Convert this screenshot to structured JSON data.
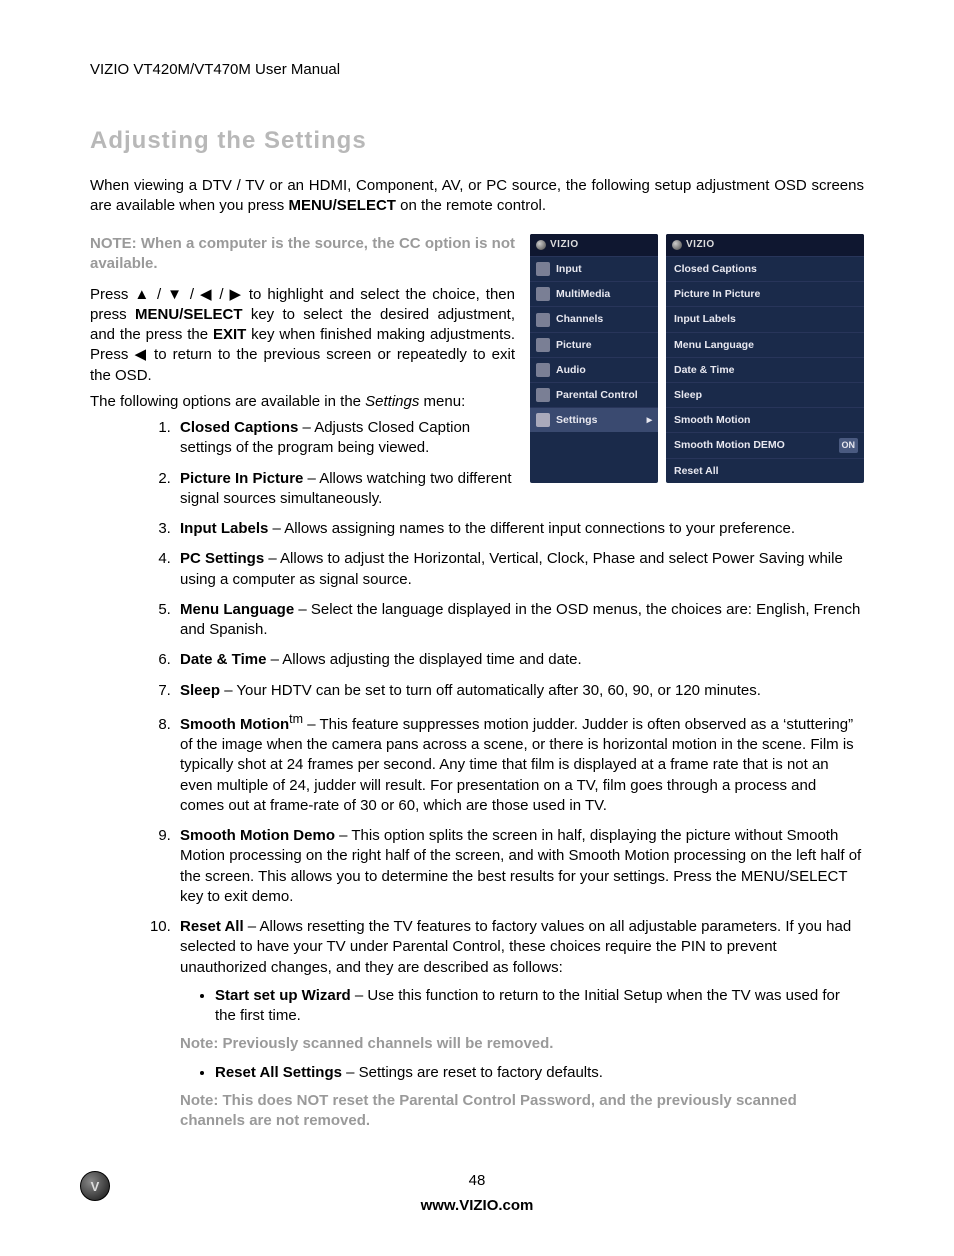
{
  "header": "VIZIO VT420M/VT470M User Manual",
  "title": "Adjusting the Settings",
  "intro_pre": "When viewing a DTV / TV or an HDMI, Component, AV, or PC source, the following setup adjustment OSD screens are available when you press ",
  "intro_bold": "MENU/SELECT",
  "intro_post": " on the remote control.",
  "note1": "NOTE: When a computer is the source, the CC option is not available.",
  "nav_p1a": "Press ",
  "nav_arrows": "▲ / ▼ / ◀ / ▶",
  "nav_p1b": " to highlight and select the choice, then press ",
  "nav_b1": "MENU/SELECT",
  "nav_p1c": " key to select the desired adjustment, and the press the ",
  "nav_b2": "EXIT",
  "nav_p1d": " key when finished making adjustments. Press ",
  "nav_arrow_left": "◀",
  "nav_p1e": " to return to the previous screen or repeatedly to exit the OSD.",
  "avail_pre": "The following options are available in the ",
  "avail_em": "Settings",
  "avail_post": " menu:",
  "osd_brand": "VIZIO",
  "osd_left": [
    "Input",
    "MultiMedia",
    "Channels",
    "Picture",
    "Audio",
    "Parental Control",
    "Settings"
  ],
  "osd_right": [
    "Closed Captions",
    "Picture In Picture",
    "Input Labels",
    "Menu Language",
    "Date & Time",
    "Sleep",
    "Smooth Motion",
    "Smooth Motion DEMO",
    "Reset All"
  ],
  "osd_demo_badge": "ON",
  "list": [
    {
      "t": "Closed Captions",
      "d": " – Adjusts Closed Caption settings of the program being viewed."
    },
    {
      "t": "Picture In Picture",
      "d": " – Allows watching two different signal sources simultaneously."
    },
    {
      "t": "Input Labels",
      "d": " – Allows assigning names to the different input connections to your preference."
    },
    {
      "t": "PC Settings",
      "d": " – Allows to adjust the Horizontal, Vertical, Clock, Phase and select Power Saving while using a computer as signal source."
    },
    {
      "t": "Menu Language",
      "d": " – Select the language displayed in the OSD menus, the choices are: English, French and Spanish."
    },
    {
      "t": "Date & Time",
      "d": " – Allows adjusting the displayed time and date."
    },
    {
      "t": "Sleep ",
      "d": " – Your HDTV can be set to turn off automatically after 30, 60, 90, or 120 minutes."
    },
    {
      "t": "Smooth Motion",
      "sup": "tm",
      "d": " – This feature suppresses motion judder. Judder is often observed as a ‘stuttering” of the image when the camera pans across a scene, or there is horizontal motion in the scene. Film is typically shot at 24 frames per second. Any time that film is displayed at a frame rate that is not an even multiple of 24, judder will result. For presentation on a TV, film goes through a process and comes out at frame-rate of 30 or 60, which are those used in TV."
    },
    {
      "t": "Smooth Motion Demo",
      "d": " – This option splits the screen in half, displaying the picture without Smooth Motion processing on the right half of the screen, and with Smooth Motion processing on the left half of the screen. This allows you to determine the best results for your settings. Press the MENU/SELECT key to exit demo."
    },
    {
      "t": "Reset All",
      "d": " – Allows resetting the TV features to factory values on all adjustable parameters. If you had selected to have your TV under Parental Control, these choices require the PIN to prevent unauthorized changes, and they are described as follows:"
    }
  ],
  "sub1_t": "Start set up Wizard",
  "sub1_d": " – Use this function to return to the Initial Setup when the TV was used for the first time.",
  "sub_note1": "Note: Previously scanned channels will be removed.",
  "sub2_t": "Reset All Settings",
  "sub2_d": " – Settings are reset to factory defaults.",
  "sub_note2": "Note: This does NOT reset the Parental Control Password, and the previously scanned channels are not removed.",
  "page_num": "48",
  "url": "www.VIZIO.com",
  "logo_letter": "V"
}
